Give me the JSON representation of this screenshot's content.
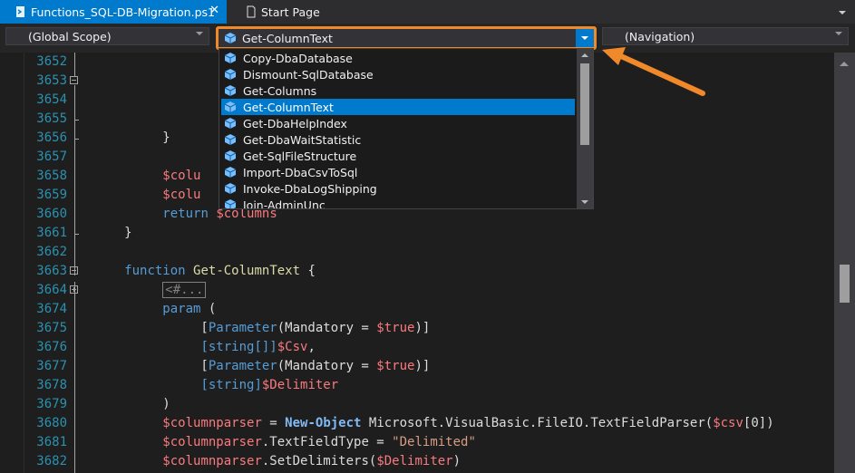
{
  "tabs": [
    {
      "label": "Functions_SQL-DB-Migration.ps1",
      "active": true,
      "icon": "powershell-file-icon"
    },
    {
      "label": "Start Page",
      "active": false,
      "icon": "page-icon"
    }
  ],
  "tab_close": "✕",
  "navigation_bar": {
    "scope": "(Global Scope)",
    "member": "Get-ColumnText",
    "navigation": "(Navigation)"
  },
  "dropdown": {
    "items": [
      "Copy-DbaDatabase",
      "Dismount-SqlDatabase",
      "Get-Columns",
      "Get-ColumnText",
      "Get-DbaHelpIndex",
      "Get-DbaWaitStatistic",
      "Get-SqlFileStructure",
      "Import-DbaCsvToSql",
      "Invoke-DbaLogShipping",
      "Join-AdminUnc"
    ],
    "selected": "Get-ColumnText"
  },
  "editor": {
    "line_numbers": [
      "3652",
      "3653",
      "3654",
      "3655",
      "3656",
      "3657",
      "3658",
      "3659",
      "3660",
      "3661",
      "3662",
      "3663",
      "3664",
      "3674",
      "3675",
      "3676",
      "3677",
      "3678",
      "3679",
      "3680",
      "3681",
      "3682"
    ],
    "partial": {
      "colu": "$colu",
      "close_brace": "}",
      "return_kw": "return",
      "columns_var": "$columns",
      "function_kw": "function",
      "function_name": "Get-ColumnText",
      "open_brace": "{",
      "collapsed_block": "<#...",
      "param_kw": "param",
      "open_paren": "(",
      "close_paren": ")",
      "parameter_attr": "Parameter",
      "mandatory": "(Mandatory = ",
      "true_var": "$true",
      "close_bracket": ")]",
      "string_arr_type": "[string[]]",
      "csv_var": "$Csv",
      "comma": ",",
      "string_type": "[string]",
      "delimiter_var": "$Delimiter",
      "columnparser_var": "$columnparser",
      "assign": " = ",
      "new_object": "New-Object",
      "textfieldparser": " Microsoft.VisualBasic.FileIO.TextFieldParser(",
      "csv_lower": "$csv",
      "index0": "[0])",
      "textfieldtype": ".TextFieldType = ",
      "delimited_str": "\"Delimited\"",
      "setdelimiters": ".SetDelimiters(",
      "close": ")"
    }
  },
  "colors": {
    "accent": "#007acc",
    "callout": "#f0892a",
    "keyword": "#569cd6",
    "variable": "#f97a7f",
    "string": "#d69d85",
    "line_number": "#2b91af"
  }
}
